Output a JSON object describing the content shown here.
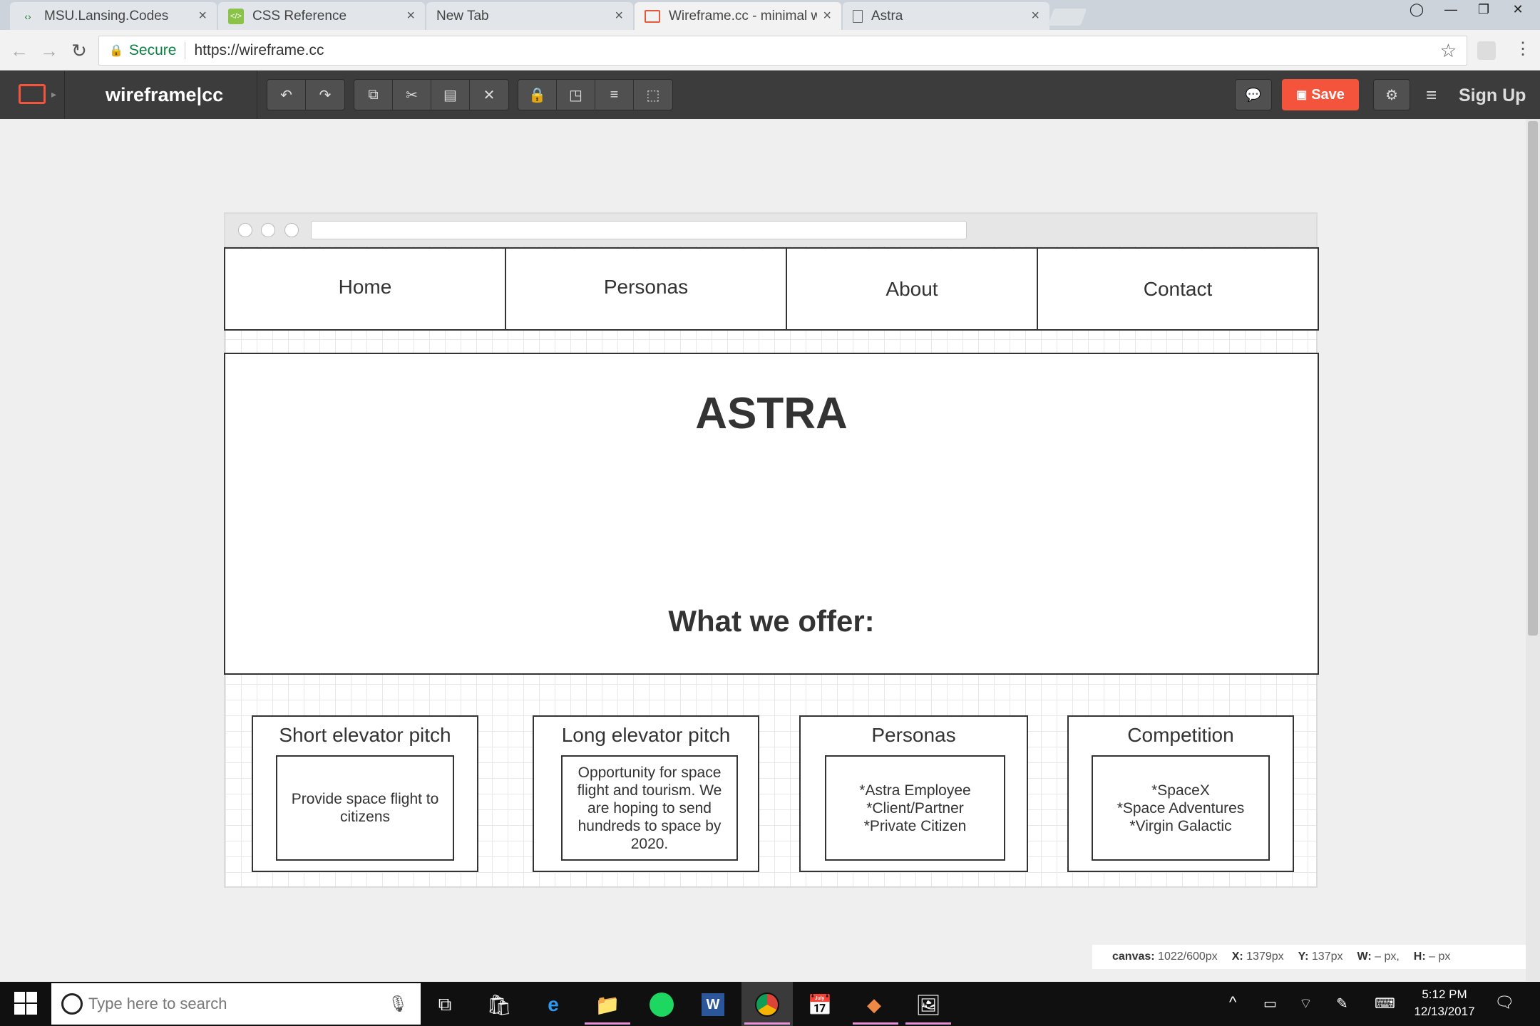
{
  "browser": {
    "tabs": [
      {
        "label": "MSU.Lansing.Codes",
        "icon": "code-icon"
      },
      {
        "label": "CSS Reference",
        "icon": "css-icon"
      },
      {
        "label": "New Tab",
        "icon": ""
      },
      {
        "label": "Wireframe.cc - minimal w",
        "icon": "wireframe-icon",
        "active": true
      },
      {
        "label": "Astra",
        "icon": "document-icon"
      }
    ],
    "secure_label": "Secure",
    "url": "https://wireframe.cc"
  },
  "app": {
    "logo": "wireframe|cc",
    "save_label": "Save",
    "signup_label": "Sign Up",
    "accent_color": "#f4543c"
  },
  "wireframe": {
    "nav": [
      "Home",
      "Personas",
      "About",
      "Contact"
    ],
    "title": "ASTRA",
    "subtitle": "What we offer:",
    "cards": [
      {
        "title": "Short elevator pitch",
        "body": "Provide space flight to citizens"
      },
      {
        "title": "Long elevator pitch",
        "body": "Opportunity for space flight and tourism. We are hoping to send hundreds to space by 2020."
      },
      {
        "title": "Personas",
        "body": "*Astra Employee\n*Client/Partner\n*Private Citizen"
      },
      {
        "title": "Competition",
        "body": "*SpaceX\n*Space Adventures\n*Virgin Galactic"
      }
    ]
  },
  "status": {
    "canvas_label": "canvas:",
    "canvas_value": "1022/600px",
    "x_label": "X:",
    "x_value": "1379px",
    "y_label": "Y:",
    "y_value": "137px",
    "w_label": "W:",
    "w_value": "– px,",
    "h_label": "H:",
    "h_value": "– px"
  },
  "taskbar": {
    "search_placeholder": "Type here to search",
    "time": "5:12 PM",
    "date": "12/13/2017"
  }
}
